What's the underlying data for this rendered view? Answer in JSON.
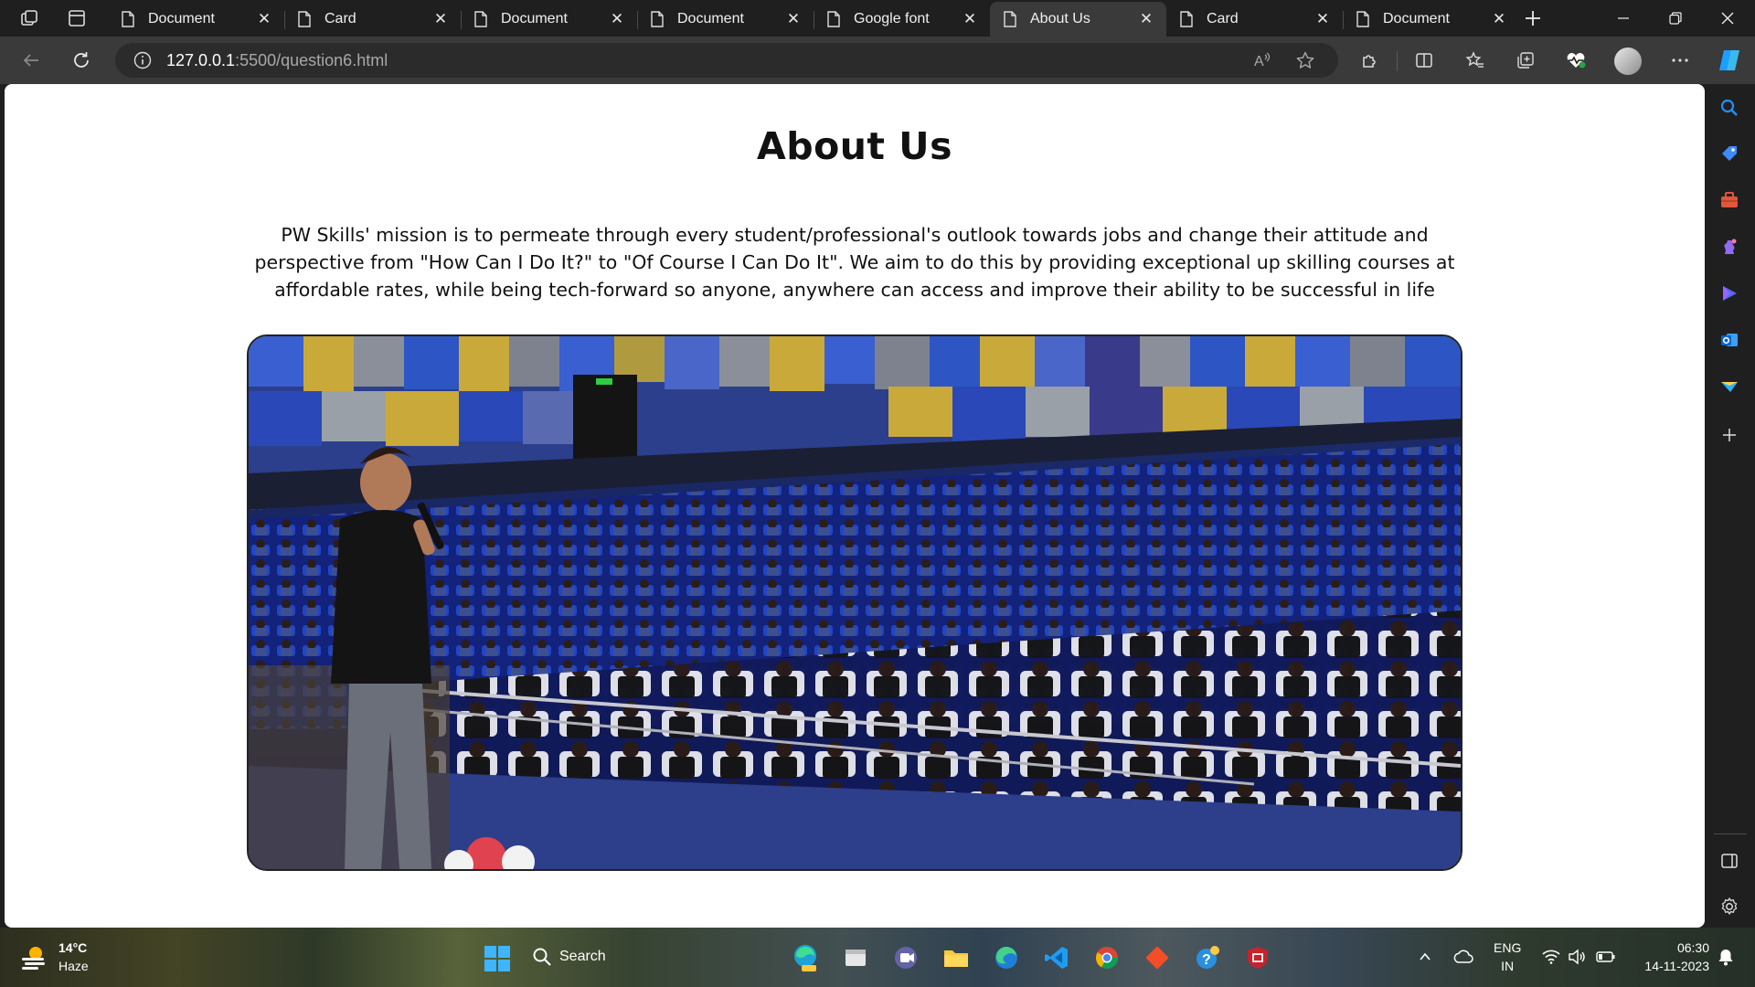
{
  "browser": {
    "tabs": [
      {
        "title": "Document",
        "active": false
      },
      {
        "title": "Card",
        "active": false
      },
      {
        "title": "Document",
        "active": false
      },
      {
        "title": "Document",
        "active": false
      },
      {
        "title": "Google font",
        "active": false
      },
      {
        "title": "About Us",
        "active": true
      },
      {
        "title": "Card",
        "active": false
      },
      {
        "title": "Document",
        "active": false
      }
    ],
    "address": {
      "host": "127.0.0.1",
      "path": ":5500/question6.html"
    }
  },
  "page": {
    "title": "About Us",
    "paragraph": "PW Skills' mission is to permeate through every student/professional's outlook towards jobs and change their attitude and perspective from \"How Can I Do It?\" to \"Of Course I Can Do It\". We aim to do this by providing exceptional up skilling courses at affordable rates, while being tech-forward so anyone, anywhere can access and improve their ability to be successful in life",
    "image": {
      "subject": "speaker-addressing-auditorium-audience",
      "seat_color": "#1e46c8",
      "wall_colors": [
        "#2a54c4",
        "#c9a93a",
        "#8a8a8a",
        "#3a3a8a"
      ]
    }
  },
  "taskbar": {
    "weather": {
      "temp": "14°C",
      "condition": "Haze"
    },
    "search_label": "Search",
    "language": {
      "line1": "ENG",
      "line2": "IN"
    },
    "clock": {
      "time": "06:30",
      "date": "14-11-2023"
    }
  },
  "colors": {
    "tab_strip": "#1f1f1f",
    "toolbar": "#3a3a3a",
    "page_bg": "#ffffff",
    "accent": "#0a84ff"
  }
}
